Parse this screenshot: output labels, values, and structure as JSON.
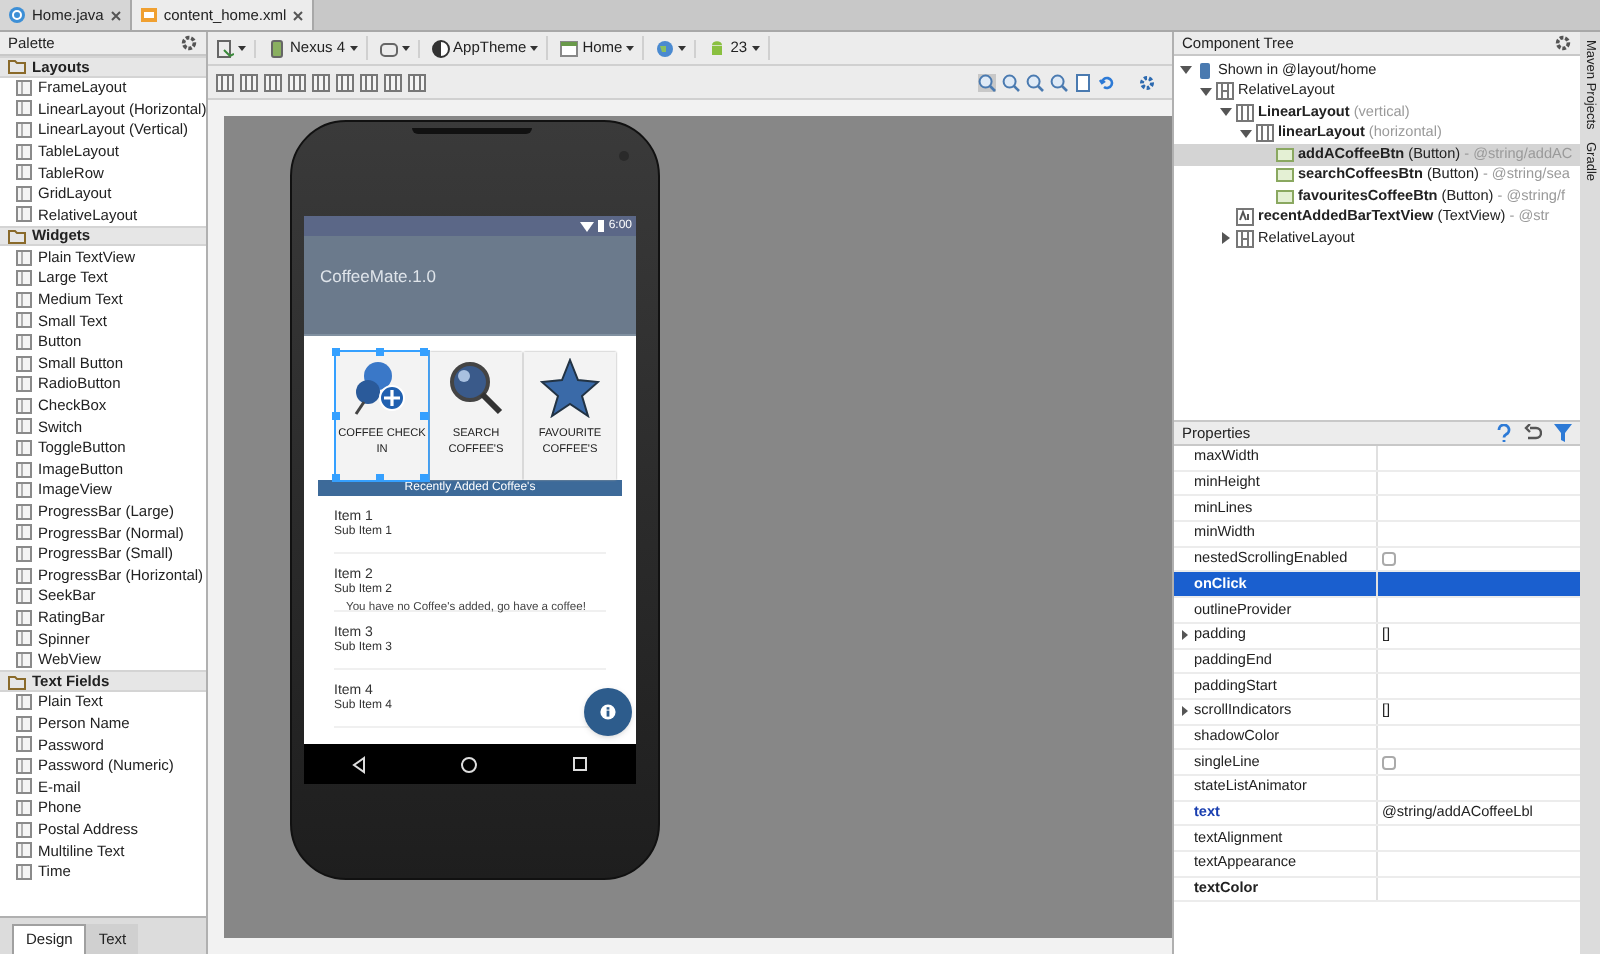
{
  "editor_tabs": [
    {
      "label": "Home.java",
      "selected": false
    },
    {
      "label": "content_home.xml",
      "selected": true
    }
  ],
  "palette": {
    "title": "Palette",
    "sections": [
      {
        "label": "Layouts",
        "items": [
          "FrameLayout",
          "LinearLayout (Horizontal)",
          "LinearLayout (Vertical)",
          "TableLayout",
          "TableRow",
          "GridLayout",
          "RelativeLayout"
        ]
      },
      {
        "label": "Widgets",
        "items": [
          "Plain TextView",
          "Large Text",
          "Medium Text",
          "Small Text",
          "Button",
          "Small Button",
          "RadioButton",
          "CheckBox",
          "Switch",
          "ToggleButton",
          "ImageButton",
          "ImageView",
          "ProgressBar (Large)",
          "ProgressBar (Normal)",
          "ProgressBar (Small)",
          "ProgressBar (Horizontal)",
          "SeekBar",
          "RatingBar",
          "Spinner",
          "WebView"
        ]
      },
      {
        "label": "Text Fields",
        "items": [
          "Plain Text",
          "Person Name",
          "Password",
          "Password (Numeric)",
          "E-mail",
          "Phone",
          "Postal Address",
          "Multiline Text",
          "Time"
        ]
      }
    ]
  },
  "toolbar": {
    "device": "Nexus 4",
    "theme": "AppTheme",
    "activity": "Home",
    "api": "23"
  },
  "preview": {
    "time": "6:00",
    "app_title": "CoffeeMate.1.0",
    "buttons": [
      {
        "label": "COFFEE CHECK IN",
        "kind": "checkin",
        "selected": true
      },
      {
        "label": "SEARCH COFFEE'S",
        "kind": "search",
        "selected": false
      },
      {
        "label": "FAVOURITE COFFEE'S",
        "kind": "star",
        "selected": false
      }
    ],
    "bar_text": "Recently Added Coffee's",
    "list": [
      {
        "title": "Item 1",
        "subtitle": "Sub Item 1"
      },
      {
        "title": "Item 2",
        "subtitle": "Sub Item 2"
      },
      {
        "title": "Item 3",
        "subtitle": "Sub Item 3"
      },
      {
        "title": "Item 4",
        "subtitle": "Sub Item 4"
      }
    ],
    "empty_message": "You have no Coffee's added, go have a coffee!"
  },
  "component_tree": {
    "title": "Component Tree",
    "nodes": [
      {
        "name": "Shown in @layout/home",
        "kind": "device",
        "expanded": true,
        "selected": false,
        "children": [
          {
            "name": "RelativeLayout",
            "kind": "relative",
            "expanded": true,
            "selected": false,
            "children": [
              {
                "name": "LinearLayout",
                "detail": "(vertical)",
                "kind": "linear",
                "expanded": true,
                "selected": false,
                "children": [
                  {
                    "name": "linearLayout",
                    "detail": "(horizontal)",
                    "kind": "linear",
                    "expanded": true,
                    "selected": false,
                    "children": [
                      {
                        "name": "addACoffeeBtn",
                        "type": "(Button)",
                        "detail": "- @string/addAC",
                        "kind": "button",
                        "selected": true
                      },
                      {
                        "name": "searchCoffeesBtn",
                        "type": "(Button)",
                        "detail": "- @string/sea",
                        "kind": "button",
                        "selected": false
                      },
                      {
                        "name": "favouritesCoffeeBtn",
                        "type": "(Button)",
                        "detail": "- @string/f",
                        "kind": "button",
                        "selected": false
                      }
                    ]
                  }
                ]
              },
              {
                "name": "recentAddedBarTextView",
                "type": "(TextView)",
                "detail": "- @str",
                "kind": "text",
                "selected": false
              },
              {
                "name": "RelativeLayout",
                "kind": "relative",
                "expanded": false,
                "selected": false
              }
            ]
          }
        ]
      }
    ]
  },
  "properties": {
    "title": "Properties",
    "rows": [
      {
        "name": "maxWidth",
        "kind": "text",
        "selected": false
      },
      {
        "name": "minHeight",
        "kind": "text",
        "selected": false
      },
      {
        "name": "minLines",
        "kind": "text",
        "selected": false
      },
      {
        "name": "minWidth",
        "kind": "text",
        "selected": false
      },
      {
        "name": "nestedScrollingEnabled",
        "kind": "checkbox",
        "checked": false,
        "selected": false
      },
      {
        "name": "onClick",
        "kind": "text",
        "selected": true
      },
      {
        "name": "outlineProvider",
        "kind": "text",
        "selected": false
      },
      {
        "name": "padding",
        "kind": "group",
        "value": "[]",
        "expanded": false,
        "selected": false
      },
      {
        "name": "paddingEnd",
        "kind": "text",
        "selected": false
      },
      {
        "name": "paddingStart",
        "kind": "text",
        "selected": false
      },
      {
        "name": "scrollIndicators",
        "kind": "group",
        "value": "[]",
        "expanded": false,
        "selected": false
      },
      {
        "name": "shadowColor",
        "kind": "text",
        "selected": false
      },
      {
        "name": "singleLine",
        "kind": "checkbox",
        "checked": false,
        "selected": false
      },
      {
        "name": "stateListAnimator",
        "kind": "text",
        "selected": false
      },
      {
        "name": "text",
        "kind": "text",
        "value": "@string/addACoffeeLbl",
        "modified": true,
        "selected": false
      },
      {
        "name": "textAlignment",
        "kind": "text",
        "selected": false
      },
      {
        "name": "textAppearance",
        "kind": "text",
        "selected": false
      },
      {
        "name": "textColor",
        "kind": "text",
        "important": true,
        "selected": false
      }
    ]
  },
  "side_tabs": [
    "Maven Projects",
    "Gradle"
  ],
  "bottom_tabs": [
    {
      "label": "Design",
      "selected": true
    },
    {
      "label": "Text",
      "selected": false
    }
  ]
}
